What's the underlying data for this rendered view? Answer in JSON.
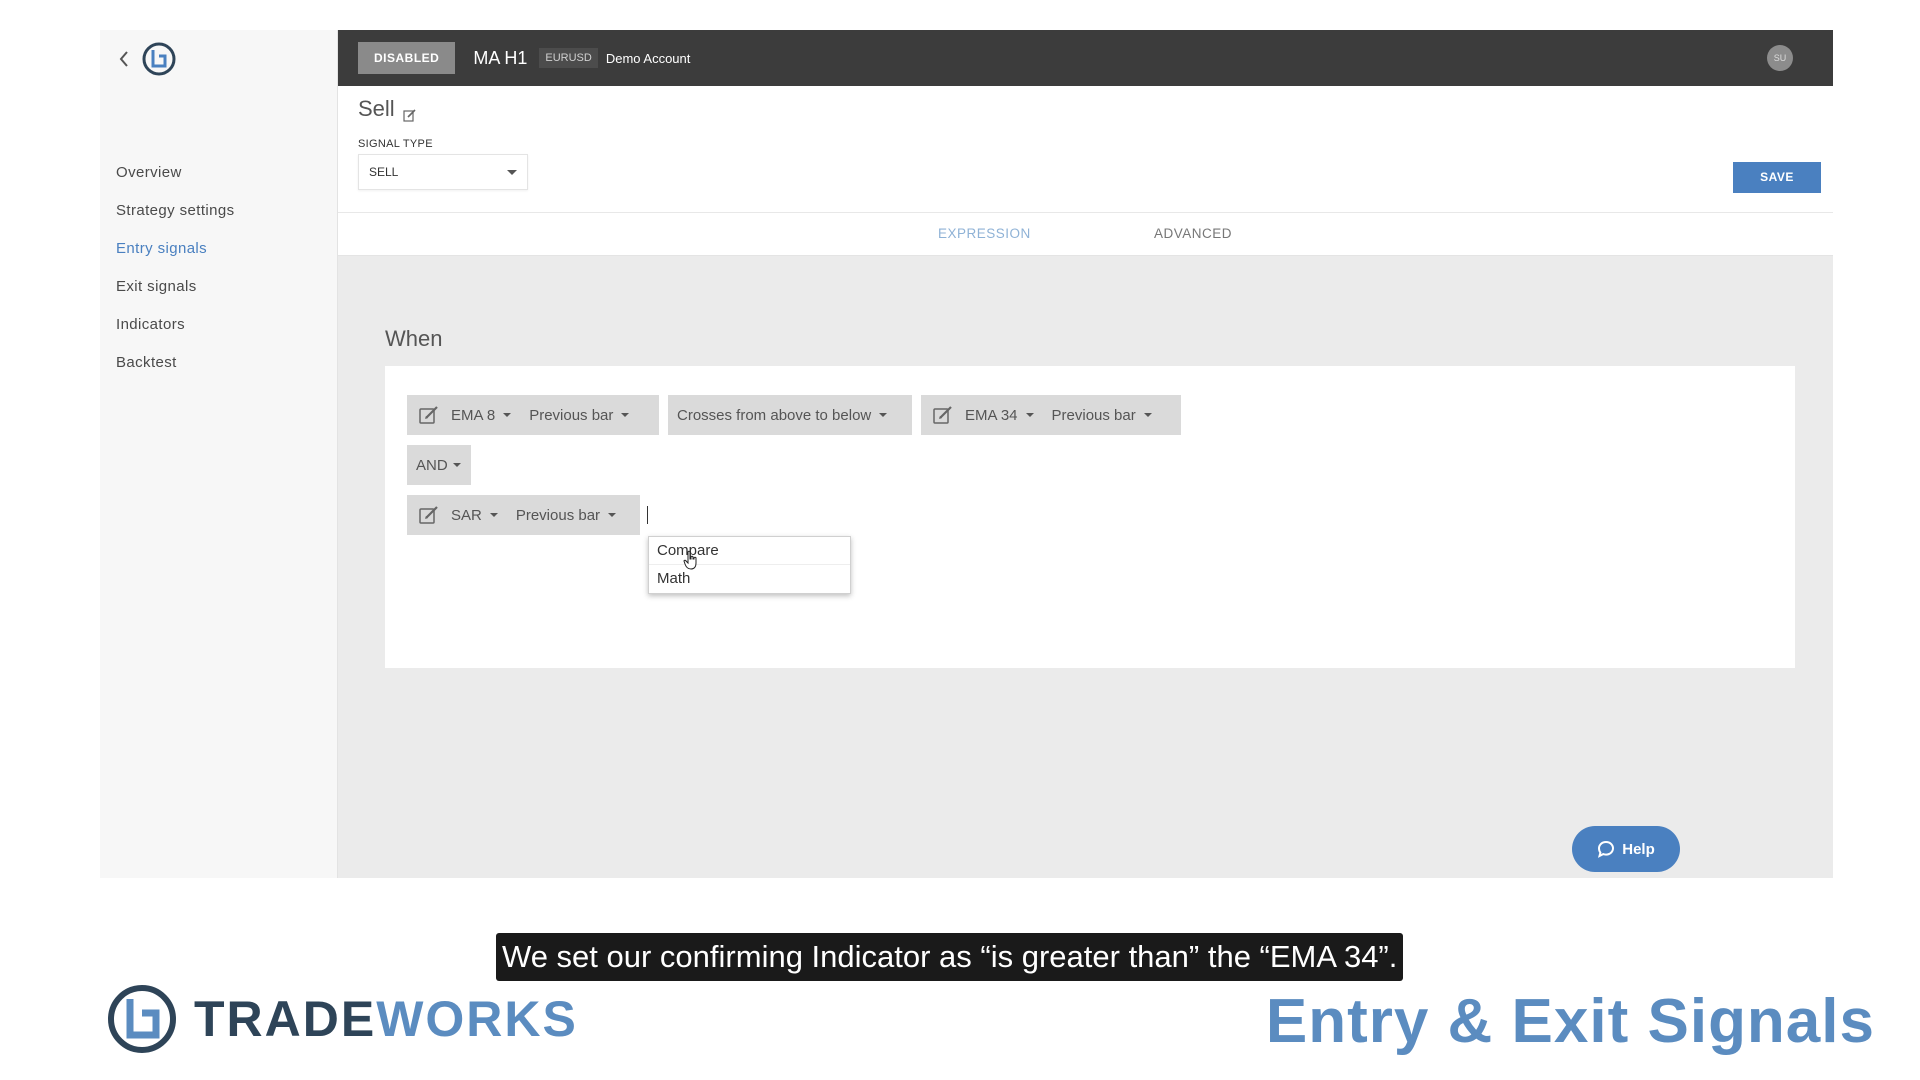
{
  "sidebar": {
    "items": [
      {
        "label": "Overview"
      },
      {
        "label": "Strategy settings"
      },
      {
        "label": "Entry signals",
        "active": true
      },
      {
        "label": "Exit signals"
      },
      {
        "label": "Indicators"
      },
      {
        "label": "Backtest"
      }
    ]
  },
  "topbar": {
    "status": "DISABLED",
    "strategy_name": "MA H1",
    "symbol": "EURUSD",
    "account": "Demo Account",
    "user_initials": "SU"
  },
  "signal": {
    "title": "Sell",
    "type_label": "SIGNAL TYPE",
    "type_value": "SELL",
    "save_label": "SAVE"
  },
  "tabs": [
    {
      "label": "EXPRESSION",
      "active": true
    },
    {
      "label": "ADVANCED",
      "active": false
    }
  ],
  "expression": {
    "when_label": "When",
    "row1": {
      "left_indicator": "EMA 8",
      "left_bar": "Previous bar",
      "operator": "Crosses from above to below",
      "right_indicator": "EMA 34",
      "right_bar": "Previous bar"
    },
    "logic": "AND",
    "row2": {
      "indicator": "SAR",
      "bar": "Previous bar"
    },
    "menu": [
      {
        "label": "Compare"
      },
      {
        "label": "Math"
      }
    ]
  },
  "help_label": "Help",
  "overlay": {
    "caption": "We set our confirming Indicator as “is greater than” the “EMA 34”.",
    "brand_part1": "TRADE",
    "brand_part2": "WORKS",
    "video_title": "Entry & Exit Signals"
  },
  "colors": {
    "accent": "#4a80c0",
    "topbar": "#3c3c3c",
    "chip": "#dadada",
    "brand_dark": "#2e4458",
    "brand_blue": "#5b8cc0"
  }
}
